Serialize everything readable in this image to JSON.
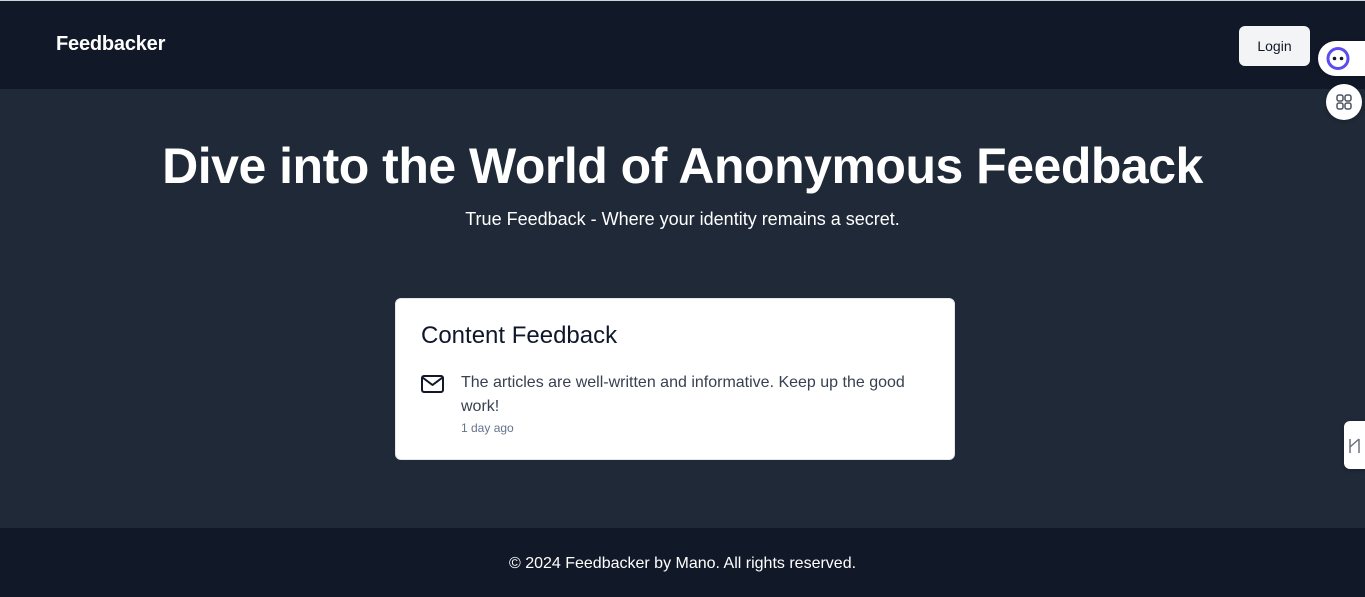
{
  "header": {
    "brand": "Feedbacker",
    "login_label": "Login"
  },
  "hero": {
    "title": "Dive into the World of Anonymous Feedback",
    "subtitle": "True Feedback - Where your identity remains a secret."
  },
  "feedback_card": {
    "title": "Content Feedback",
    "icon": "mail-icon",
    "message": "The articles are well-written and informative. Keep up the good work!",
    "time": "1 day ago"
  },
  "footer": {
    "text": "© 2024 Feedbacker by Mano. All rights reserved."
  },
  "floating_widgets": {
    "assistant_icon": "assistant-face-icon",
    "apps_icon": "apps-grid-icon",
    "side_tab_icon": "side-tab-icon"
  },
  "colors": {
    "header_bg": "#111827",
    "hero_bg": "#1f2937",
    "card_bg": "#ffffff",
    "button_bg": "#f3f4f6",
    "muted_text": "#64748b"
  }
}
